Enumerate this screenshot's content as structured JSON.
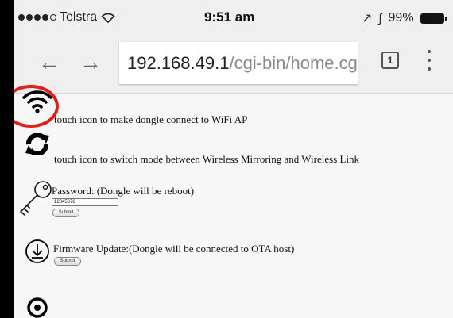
{
  "status_bar": {
    "carrier": "Telstra",
    "time": "9:51 am",
    "battery": "99%"
  },
  "browser": {
    "url_host": "192.168.49.1",
    "url_path": "/cgi-bin/home.cg",
    "tab_count": "1"
  },
  "page": {
    "wifi_text": "touch icon to make dongle connect to WiFi AP",
    "switch_text": "touch icon to switch mode between Wireless Mirroring and Wireless Link",
    "password_label": "Password: (Dongle will be reboot)",
    "password_value": "12345678",
    "password_submit": "Submit",
    "firmware_label": "Firmware Update:(Dongle will be connected to OTA host)",
    "firmware_submit": "Submit"
  },
  "colors": {
    "highlight_circle": "#e0201b"
  }
}
